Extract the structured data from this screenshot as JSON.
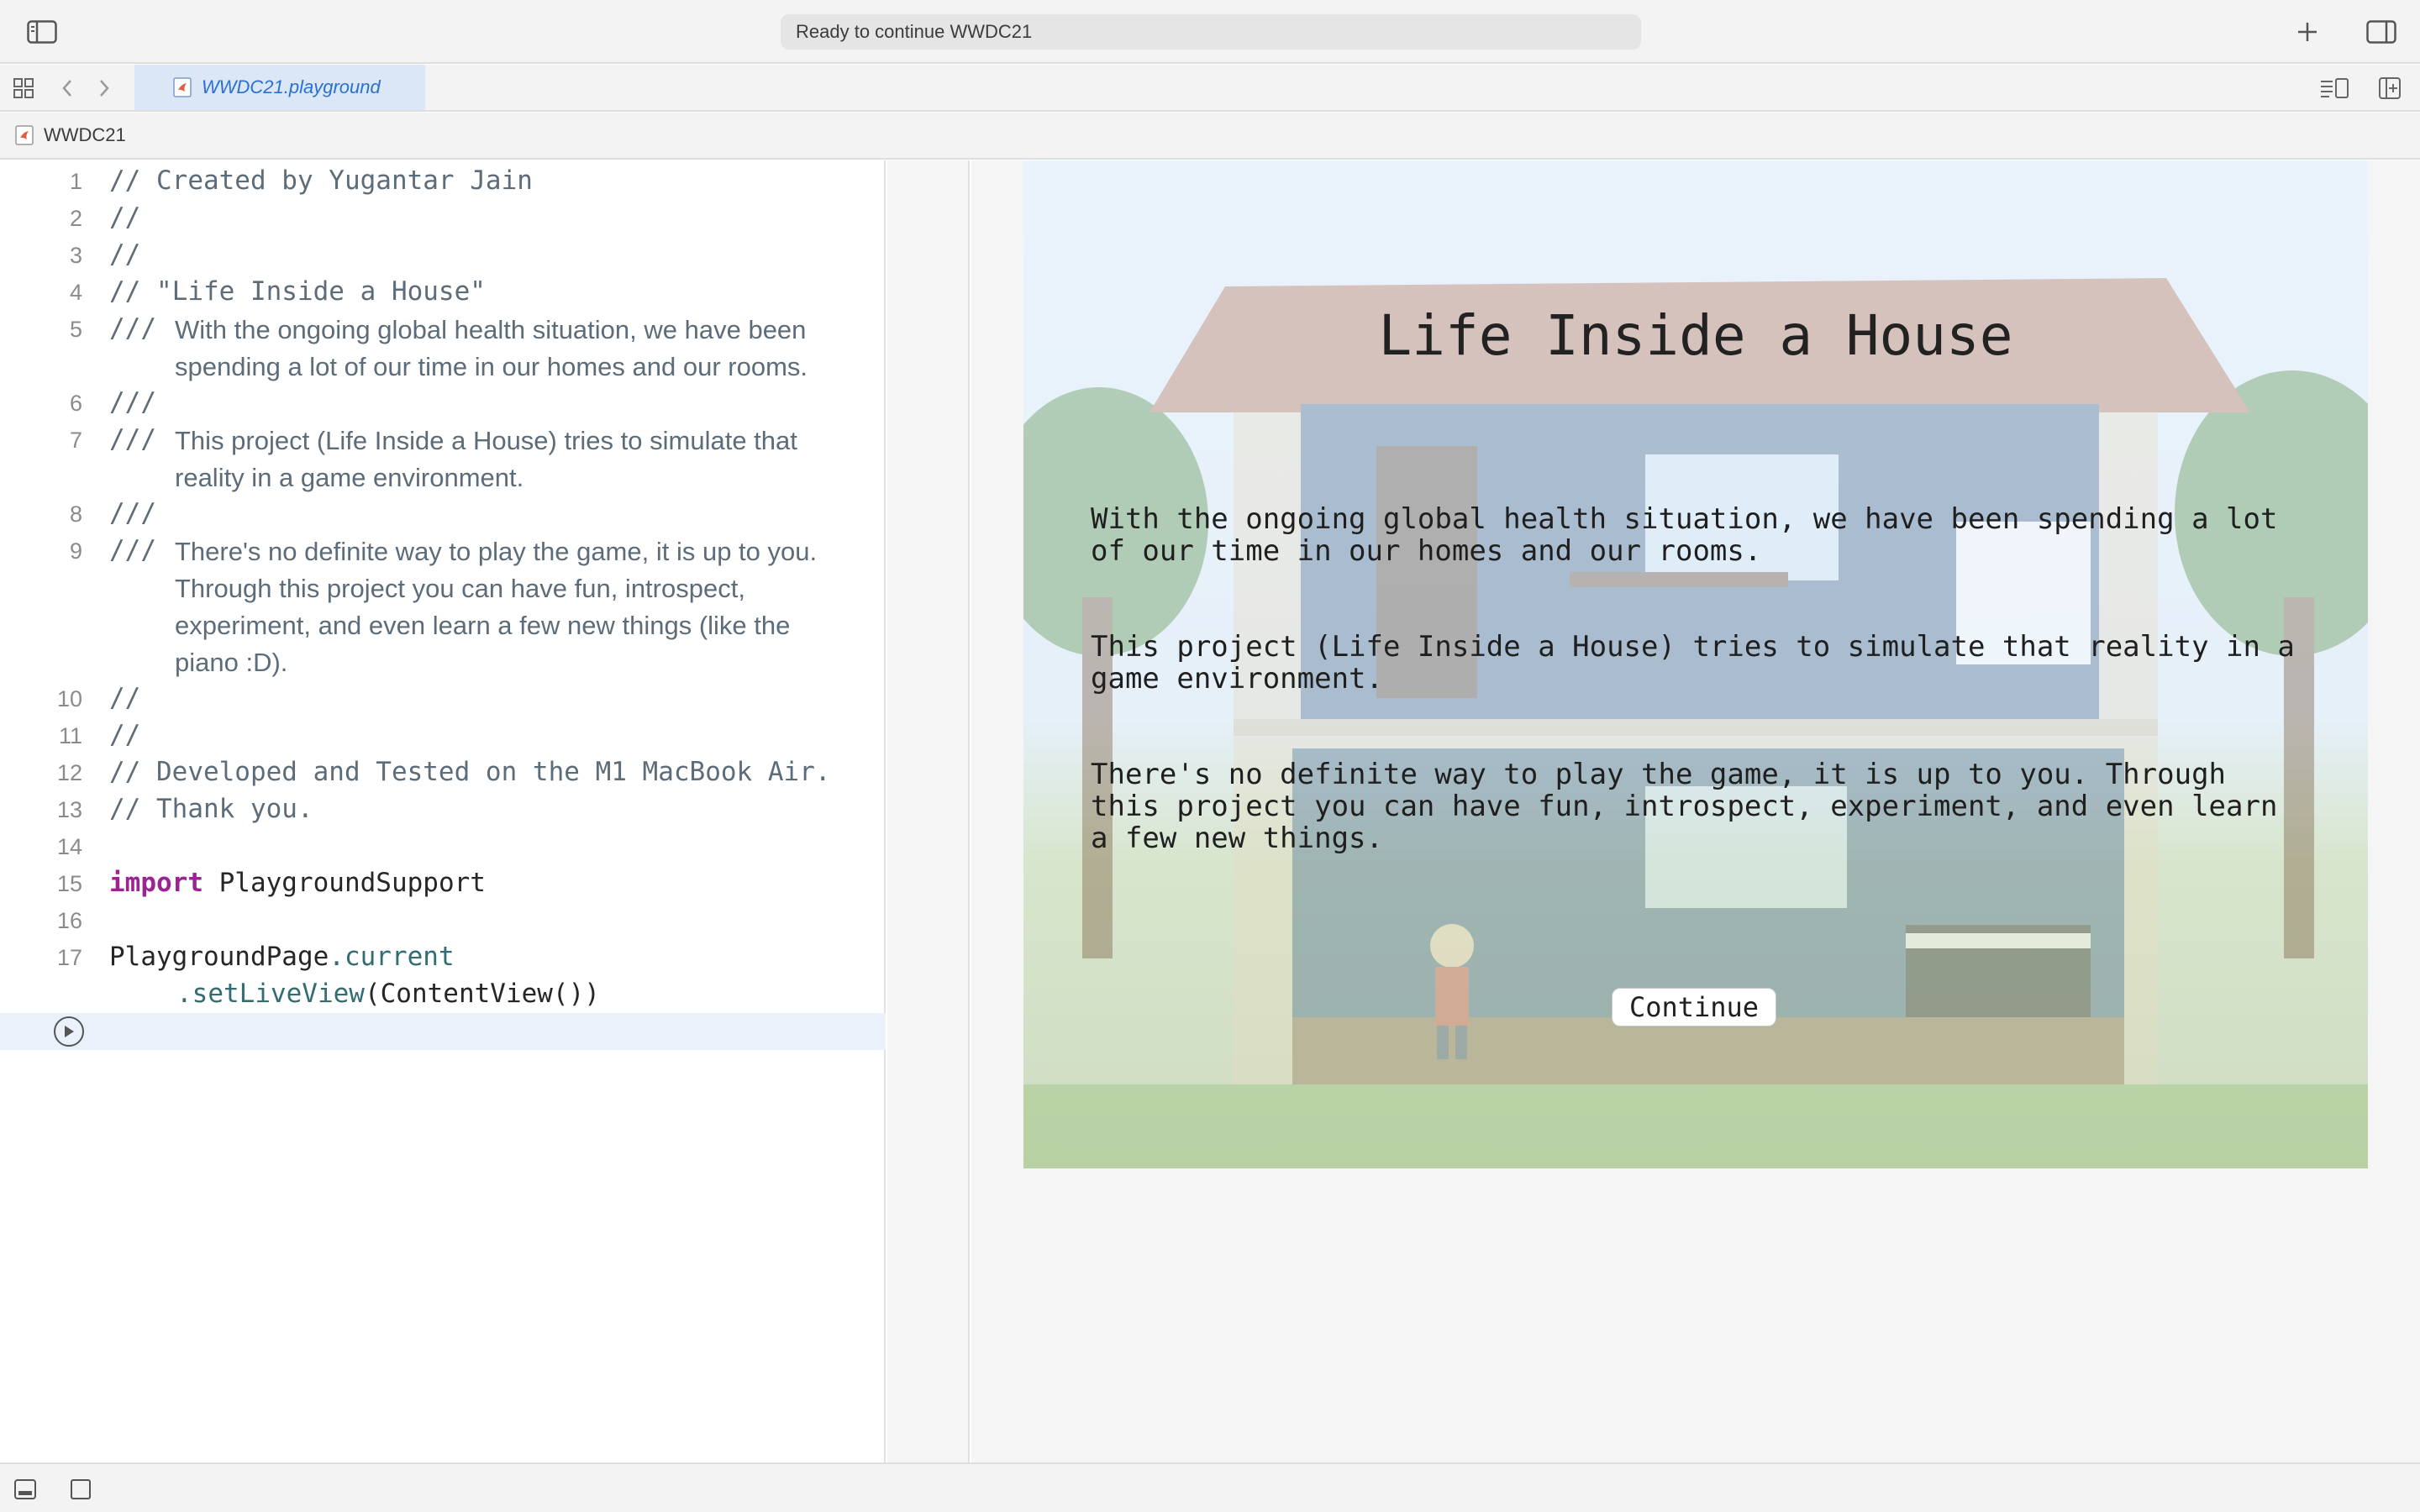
{
  "titlebar": {
    "status": "Ready to continue WWDC21",
    "icons": [
      "sidebar-toggle-icon",
      "plus-icon",
      "inspector-toggle-icon"
    ]
  },
  "tabbar": {
    "tab_label": "WWDC21.playground",
    "icons": [
      "grid-icon",
      "chevron-left-icon",
      "chevron-right-icon",
      "editor-options-icon",
      "add-editor-icon"
    ]
  },
  "breadcrumb": {
    "label": "WWDC21"
  },
  "editor": {
    "lines": [
      {
        "num": "1",
        "text": "// Created by Yugantar Jain"
      },
      {
        "num": "2",
        "text": "//"
      },
      {
        "num": "3",
        "text": "//"
      },
      {
        "num": "4",
        "text": "// \"Life Inside a House\""
      },
      {
        "num": "5",
        "prefix": "///",
        "doc": [
          "With the ongoing global health situation, we have been",
          "spending a lot of our time in our homes and our rooms."
        ]
      },
      {
        "num": "6",
        "prefix": "///"
      },
      {
        "num": "7",
        "prefix": "///",
        "doc": [
          "This project (Life Inside a House) tries to simulate that",
          "reality in a game environment."
        ]
      },
      {
        "num": "8",
        "prefix": "///"
      },
      {
        "num": "9",
        "prefix": "///",
        "doc": [
          "There's no definite way to play the game, it is up to you.",
          "Through this project you can have fun, introspect,",
          "experiment, and even learn a few new things (like the",
          "piano :D)."
        ]
      },
      {
        "num": "10",
        "text": "//"
      },
      {
        "num": "11",
        "text": "//"
      },
      {
        "num": "12",
        "text": "// Developed and Tested on the M1 MacBook Air."
      },
      {
        "num": "13",
        "text": "// Thank you."
      },
      {
        "num": "14",
        "text": ""
      },
      {
        "num": "15",
        "keyword": "import",
        "rest": " PlaygroundSupport"
      },
      {
        "num": "16",
        "text": ""
      },
      {
        "num": "17",
        "code1_a": "PlaygroundPage",
        "code1_b": ".current",
        "code2_a": ".setLiveView",
        "code2_b": "(ContentView())"
      }
    ]
  },
  "liveview": {
    "title": "Life Inside a House",
    "paragraphs": [
      "With the ongoing global health situation, we have been spending a lot of our time in our homes and our rooms.",
      "This project (Life Inside a House) tries to simulate that reality in a game environment.",
      "There's no definite way to play the game, it is up to you. Through this project you can have fun, introspect, experiment, and even learn a few new things."
    ],
    "continue_label": "Continue"
  },
  "bottombar": {
    "icons": [
      "hide-debug-area-icon",
      "console-icon"
    ]
  }
}
